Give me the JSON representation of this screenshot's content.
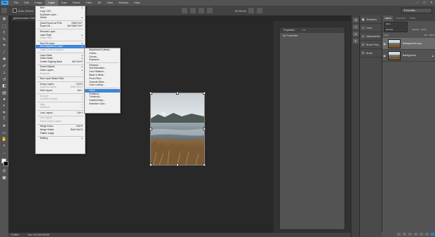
{
  "app": {
    "logo": "Ps"
  },
  "menubar": {
    "items": [
      "File",
      "Edit",
      "Image",
      "Layer",
      "Type",
      "Select",
      "Filter",
      "3D",
      "View",
      "Window",
      "Help"
    ],
    "window_controls": [
      "−",
      "□",
      "×"
    ]
  },
  "options": {
    "auto_select_label": "Auto-Select:",
    "auto_select_value": "Layer",
    "mode_label": "3D Mode:",
    "workspace": "Essentials"
  },
  "document": {
    "tab_title": "gemma-mann-7418... @ 12.9% (RGB/8)",
    "zoom": "12.88%",
    "doc_info": "Doc: 54.2M/108.5M"
  },
  "layer_menu": [
    {
      "label": "New",
      "arrow": true
    },
    {
      "label": "Copy CSS"
    },
    {
      "label": "Duplicate Layer..."
    },
    {
      "label": "Delete",
      "arrow": true
    },
    {
      "sep": true
    },
    {
      "label": "Quick Export as PNG",
      "shortcut": "Shift+Ctrl+'"
    },
    {
      "label": "Export As...",
      "shortcut": "Alt+Shift+Ctrl+'"
    },
    {
      "sep": true
    },
    {
      "label": "Rename Layer..."
    },
    {
      "label": "Layer Style",
      "arrow": true
    },
    {
      "label": "Smart Filter",
      "arrow": true,
      "disabled": true
    },
    {
      "sep": true
    },
    {
      "label": "New Fill Layer",
      "arrow": true
    },
    {
      "label": "New Adjustment Layer",
      "arrow": true,
      "highlight": true
    },
    {
      "label": "Layer Content Options...",
      "disabled": true
    },
    {
      "sep": true
    },
    {
      "label": "Layer Mask",
      "arrow": true
    },
    {
      "label": "Vector Mask",
      "arrow": true
    },
    {
      "label": "Create Clipping Mask",
      "shortcut": "Alt+Ctrl+G"
    },
    {
      "sep": true
    },
    {
      "label": "Smart Objects",
      "arrow": true
    },
    {
      "label": "Video Layers",
      "arrow": true
    },
    {
      "label": "Rasterize",
      "arrow": true,
      "disabled": true
    },
    {
      "sep": true
    },
    {
      "label": "New Layer Based Slice"
    },
    {
      "sep": true
    },
    {
      "label": "Group Layers",
      "shortcut": "Ctrl+G"
    },
    {
      "label": "Ungroup Layers",
      "shortcut": "Shift+Ctrl+G",
      "disabled": true
    },
    {
      "label": "Hide Layers",
      "shortcut": "Ctrl+,"
    },
    {
      "sep": true
    },
    {
      "label": "Arrange",
      "arrow": true,
      "disabled": true
    },
    {
      "label": "Combine Shapes",
      "arrow": true,
      "disabled": true
    },
    {
      "sep": true
    },
    {
      "label": "Align",
      "arrow": true,
      "disabled": true
    },
    {
      "label": "Distribute",
      "arrow": true,
      "disabled": true
    },
    {
      "sep": true
    },
    {
      "label": "Lock Layers...",
      "shortcut": "Ctrl+/"
    },
    {
      "sep": true
    },
    {
      "label": "Link Layers",
      "disabled": true
    },
    {
      "label": "Select Linked Layers",
      "disabled": true
    },
    {
      "sep": true
    },
    {
      "label": "Merge Down",
      "shortcut": "Ctrl+E"
    },
    {
      "label": "Merge Visible",
      "shortcut": "Shift+Ctrl+E"
    },
    {
      "label": "Flatten Image"
    },
    {
      "sep": true
    },
    {
      "label": "Matting",
      "arrow": true
    }
  ],
  "adjustment_menu": [
    {
      "label": "Brightness/Contrast..."
    },
    {
      "label": "Levels..."
    },
    {
      "label": "Curves..."
    },
    {
      "label": "Exposure..."
    },
    {
      "sep": true
    },
    {
      "label": "Vibrance..."
    },
    {
      "label": "Hue/Saturation..."
    },
    {
      "label": "Color Balance..."
    },
    {
      "label": "Black & White..."
    },
    {
      "label": "Photo Filter..."
    },
    {
      "label": "Channel Mixer..."
    },
    {
      "label": "Color Lookup..."
    },
    {
      "sep": true
    },
    {
      "label": "Invert...",
      "highlight": true
    },
    {
      "label": "Posterize..."
    },
    {
      "label": "Threshold..."
    },
    {
      "label": "Gradient Map..."
    },
    {
      "label": "Selective Color..."
    }
  ],
  "properties": {
    "tabs": [
      "Properties",
      "Info"
    ],
    "body": "No Properties"
  },
  "dock_panels": [
    "Swatches",
    "Color",
    "Adjustments",
    "Brush Pres...",
    "Brush"
  ],
  "layers_panel": {
    "tabs": [
      "Layers",
      "Channels",
      "Paths"
    ],
    "filter_label": "Kind",
    "blend_mode": "Normal",
    "opacity_label": "Opacity:",
    "opacity": "100%",
    "lock_label": "Lock:",
    "fill_label": "Fill:",
    "fill": "100%",
    "layers": [
      {
        "name": "Background copy",
        "selected": true
      },
      {
        "name": "Background",
        "locked": true
      }
    ]
  },
  "colors": {
    "accent": "#3e86d6",
    "ps_blue": "#31a8ff",
    "menubar": "#535353"
  }
}
